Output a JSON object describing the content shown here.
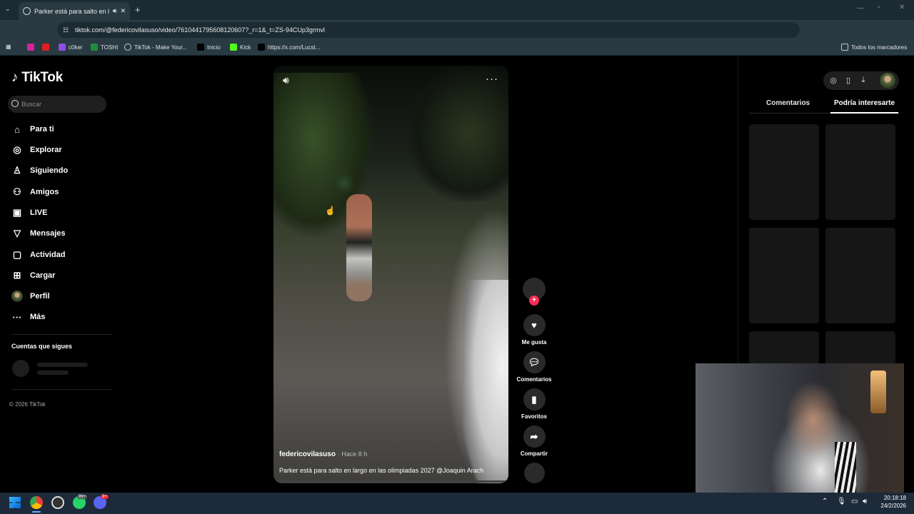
{
  "browser": {
    "tab_title": "Parker está para salto en la",
    "url": "tiktok.com/@federicovilasuso/video/7610441795608120607?_r=1&_t=ZS-94CUp3grmvl",
    "bookmarks": [
      "c0ker",
      "TOSHI",
      "TikTok - Make Your...",
      "Inicio",
      "Kick",
      "https://x.com/Lucst..."
    ],
    "all_bookmarks": "Todos los marcadores"
  },
  "sidebar": {
    "logo": "TikTok",
    "search_placeholder": "Buscar",
    "items": [
      {
        "label": "Para ti",
        "icon": "home-icon"
      },
      {
        "label": "Explorar",
        "icon": "compass-icon"
      },
      {
        "label": "Siguiendo",
        "icon": "following-icon"
      },
      {
        "label": "Amigos",
        "icon": "friends-icon"
      },
      {
        "label": "LIVE",
        "icon": "live-icon"
      },
      {
        "label": "Mensajes",
        "icon": "messages-icon"
      },
      {
        "label": "Actividad",
        "icon": "activity-icon"
      },
      {
        "label": "Cargar",
        "icon": "upload-icon"
      },
      {
        "label": "Perfil",
        "icon": "avatar-icon"
      },
      {
        "label": "Más",
        "icon": "more-icon"
      }
    ],
    "following_title": "Cuentas que sigues",
    "copyright": "© 2026 TikTok"
  },
  "video": {
    "author": "federicovilasuso",
    "time": "· Hace 8 h",
    "caption": "Parker está para salto en largo en las olimpiadas 2027 @Joaquin Arach"
  },
  "actions": {
    "like": "Me gusta",
    "comments": "Comentarios",
    "favorites": "Favoritos",
    "share": "Compartir"
  },
  "right_panel": {
    "tab_comments": "Comentarios",
    "tab_interest": "Podría interesarte"
  },
  "taskbar": {
    "time": "20:18:18",
    "date": "24/2/2026",
    "badge_whatsapp": "99+",
    "badge_discord": "9+"
  }
}
